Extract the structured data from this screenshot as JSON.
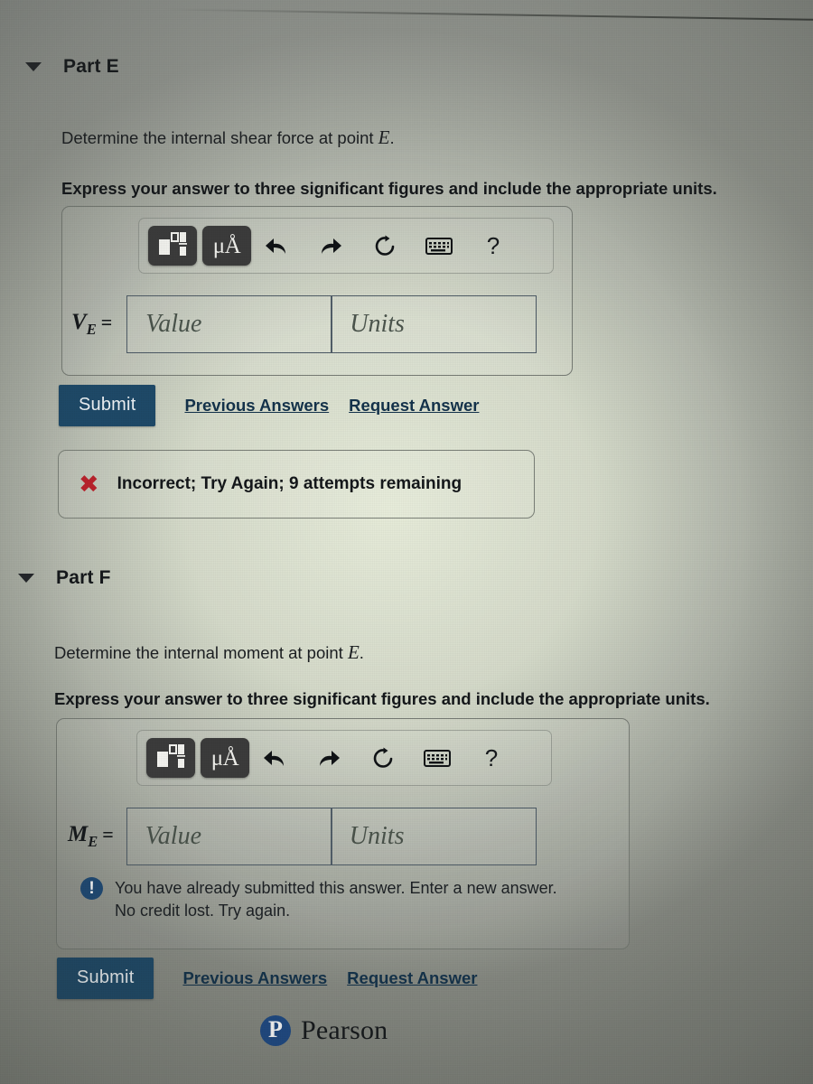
{
  "page": {
    "background_center": "#e8eedc",
    "background_edge": "#8f9289",
    "brand_navy": "#1b4a6b",
    "error_red": "#c2202a"
  },
  "parts": [
    {
      "id": "part-e",
      "header_label": "Part E",
      "disclosure_icon": "triangle-down-icon",
      "prompt_prefix": "Determine the internal shear force at point ",
      "prompt_variable": "E",
      "prompt_suffix": ".",
      "instruction": "Express your answer to three significant figures and include the appropriate units.",
      "toolbar": {
        "buttons": [
          {
            "name": "math-template-button",
            "icon": "math-template-icon",
            "label": ""
          },
          {
            "name": "units-button",
            "icon": "mu-angstrom-icon",
            "label": "μÅ"
          }
        ],
        "icons": [
          {
            "name": "undo-button",
            "icon": "undo-arrow-icon"
          },
          {
            "name": "redo-button",
            "icon": "redo-arrow-icon"
          },
          {
            "name": "reset-button",
            "icon": "reset-circular-arrow-icon"
          },
          {
            "name": "keyboard-button",
            "icon": "keyboard-icon"
          }
        ],
        "help_label": "?"
      },
      "answer": {
        "variable": "V",
        "subscript": "E",
        "equals": "=",
        "value_placeholder": "Value",
        "value_text": "",
        "units_placeholder": "Units",
        "units_text": ""
      },
      "actions": {
        "submit_label": "Submit",
        "previous_answers_label": "Previous Answers",
        "request_answer_label": "Request Answer"
      },
      "feedback": {
        "icon": "x-mark-icon",
        "text": "Incorrect; Try Again; 9 attempts remaining"
      }
    },
    {
      "id": "part-f",
      "header_label": "Part F",
      "disclosure_icon": "triangle-down-icon",
      "prompt_prefix": "Determine the internal moment at point ",
      "prompt_variable": "E",
      "prompt_suffix": ".",
      "instruction": "Express your answer to three significant figures and include the appropriate units.",
      "toolbar": {
        "buttons": [
          {
            "name": "math-template-button",
            "icon": "math-template-icon",
            "label": ""
          },
          {
            "name": "units-button",
            "icon": "mu-angstrom-icon",
            "label": "μÅ"
          }
        ],
        "icons": [
          {
            "name": "undo-button",
            "icon": "undo-arrow-icon"
          },
          {
            "name": "redo-button",
            "icon": "redo-arrow-icon"
          },
          {
            "name": "reset-button",
            "icon": "reset-circular-arrow-icon"
          },
          {
            "name": "keyboard-button",
            "icon": "keyboard-icon"
          }
        ],
        "help_label": "?"
      },
      "answer": {
        "variable": "M",
        "subscript": "E",
        "equals": "=",
        "value_placeholder": "Value",
        "value_text": "",
        "units_placeholder": "Units",
        "units_text": ""
      },
      "notice": {
        "icon": "exclamation-circle-icon",
        "line1": "You have already submitted this answer. Enter a new answer.",
        "line2": "No credit lost. Try again."
      },
      "actions": {
        "submit_label": "Submit",
        "previous_answers_label": "Previous Answers",
        "request_answer_label": "Request Answer"
      }
    }
  ],
  "footer": {
    "brand_mark": "P",
    "brand_name": "Pearson"
  }
}
